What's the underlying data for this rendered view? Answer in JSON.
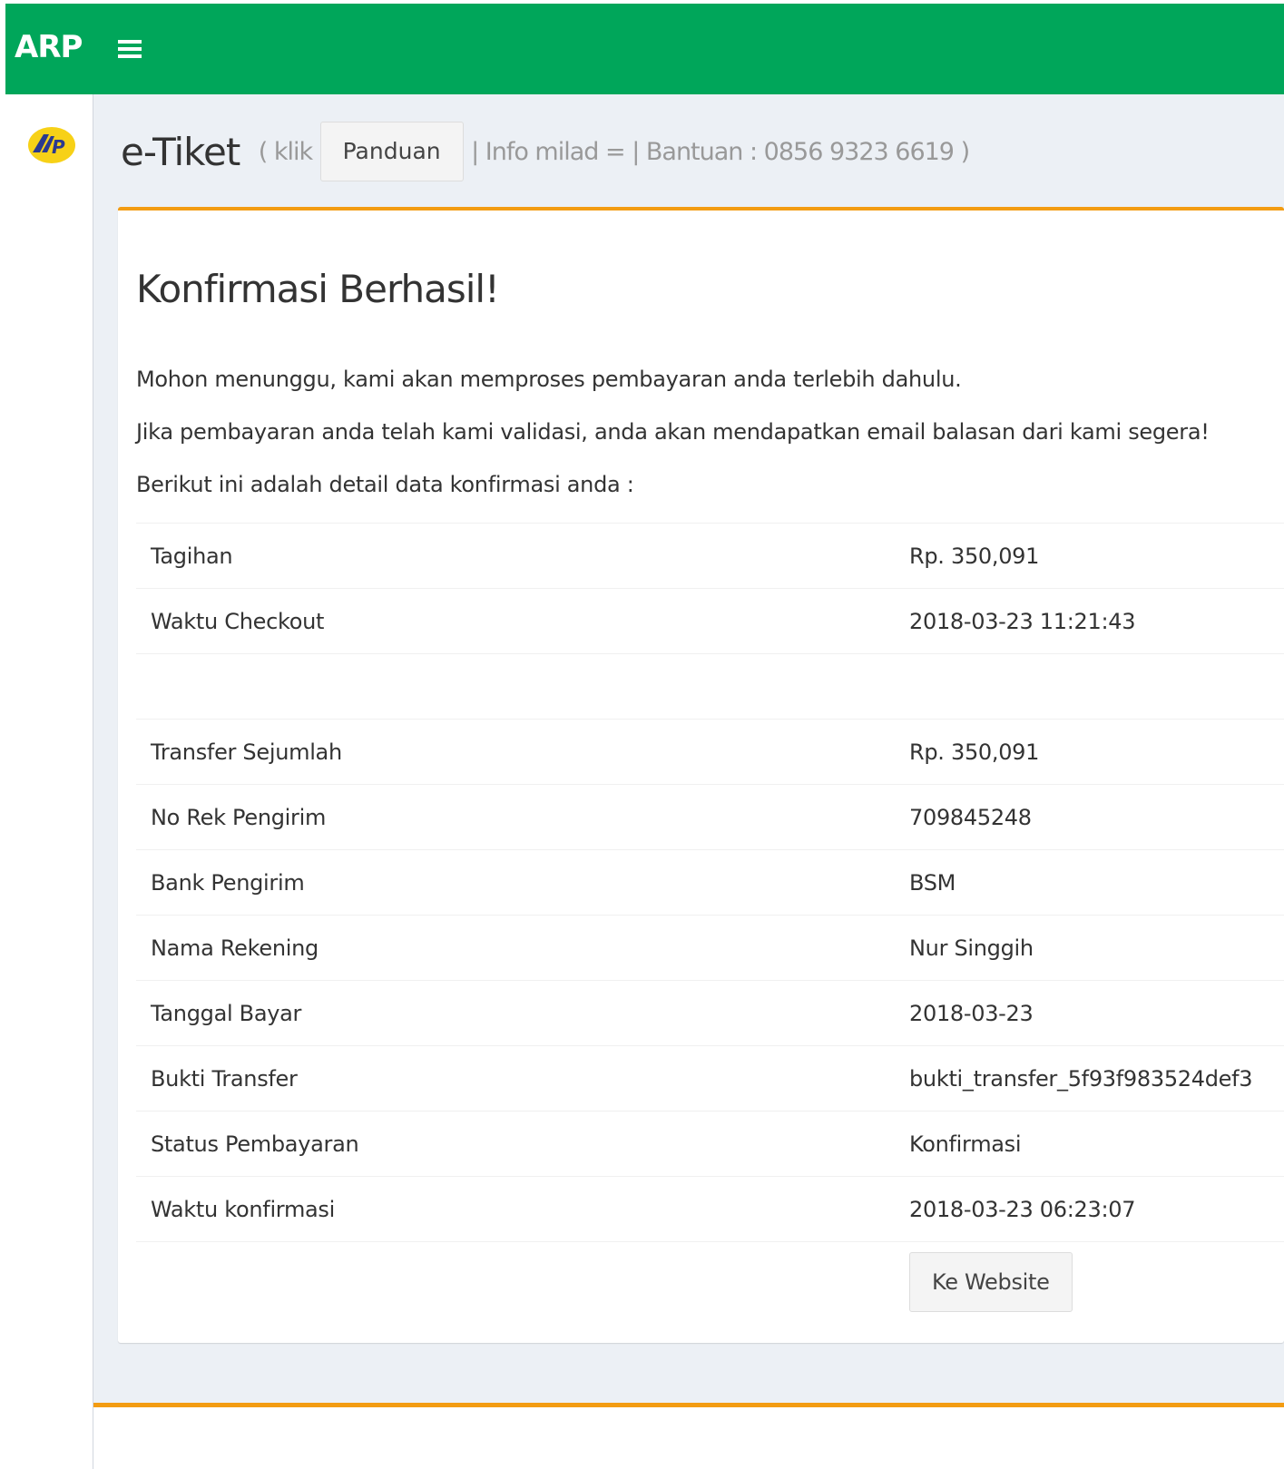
{
  "header": {
    "brand": "ARP",
    "brand_color": "#00a65a"
  },
  "page": {
    "title": "e-Tiket",
    "pre_text": "( klik",
    "guide_button": "Panduan",
    "post_text": "| Info milad = | Bantuan : 0856 9323 6619 )"
  },
  "box": {
    "accent_color": "#f39c12",
    "title": "Konfirmasi Berhasil!",
    "paragraphs": [
      "Mohon menunggu, kami akan memproses pembayaran anda terlebih dahulu.",
      "Jika pembayaran anda telah kami validasi, anda akan mendapatkan email balasan dari kami segera!",
      "Berikut ini adalah detail data konfirmasi anda :"
    ],
    "rows": [
      {
        "label": "Tagihan",
        "value": "Rp. 350,091"
      },
      {
        "label": "Waktu Checkout",
        "value": "2018-03-23 11:21:43"
      },
      {
        "label": "Transfer Sejumlah",
        "value": "Rp. 350,091"
      },
      {
        "label": "No Rek Pengirim",
        "value": "709845248"
      },
      {
        "label": "Bank Pengirim",
        "value": "BSM"
      },
      {
        "label": "Nama Rekening",
        "value": "Nur Singgih"
      },
      {
        "label": "Tanggal Bayar",
        "value": "2018-03-23"
      },
      {
        "label": "Bukti Transfer",
        "value": "bukti_transfer_5f93f983524def3"
      },
      {
        "label": "Status Pembayaran",
        "value": "Konfirmasi"
      },
      {
        "label": "Waktu konfirmasi",
        "value": "2018-03-23 06:23:07"
      }
    ],
    "website_button": "Ke Website"
  }
}
